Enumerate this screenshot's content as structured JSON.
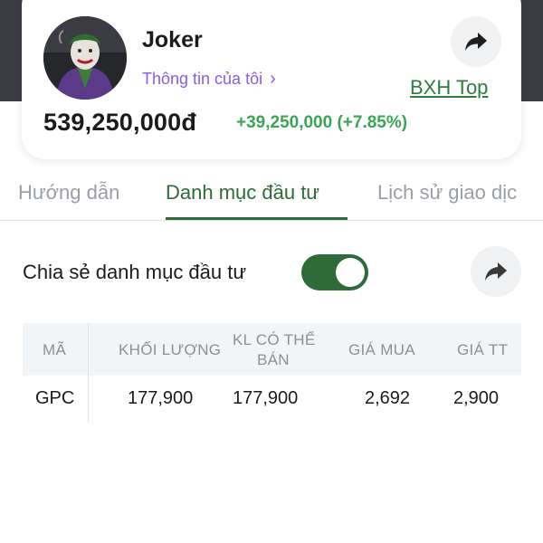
{
  "profile": {
    "name": "Joker",
    "info_link": "Thông tin của tôi",
    "rank_link": "BXH Top",
    "balance": "539,250,000đ",
    "change": "+39,250,000 (+7.85%)"
  },
  "tabs": [
    {
      "label": "Hướng dẫn",
      "active": false
    },
    {
      "label": "Danh mục đầu tư",
      "active": true
    },
    {
      "label": "Lịch sử giao dịc",
      "active": false
    }
  ],
  "share_portfolio": {
    "label": "Chia sẻ danh mục đầu tư",
    "enabled": true
  },
  "table": {
    "headers": [
      "MÃ",
      "KHỐI LƯỢNG",
      "KL CÓ THỂ",
      "BÁN",
      "GIÁ MUA",
      "GIÁ TT"
    ],
    "rows": [
      {
        "code": "GPC",
        "volume": "177,900",
        "sellable": "177,900",
        "buy_price": "2,692",
        "market_price": "2,900"
      }
    ]
  },
  "colors": {
    "accent_green": "#2e6b39",
    "gain_green": "#3aa655",
    "purple_link": "#8c5ce8"
  },
  "icons": {
    "share": "share-arrow-icon",
    "chevron": "chevron-right-icon"
  }
}
